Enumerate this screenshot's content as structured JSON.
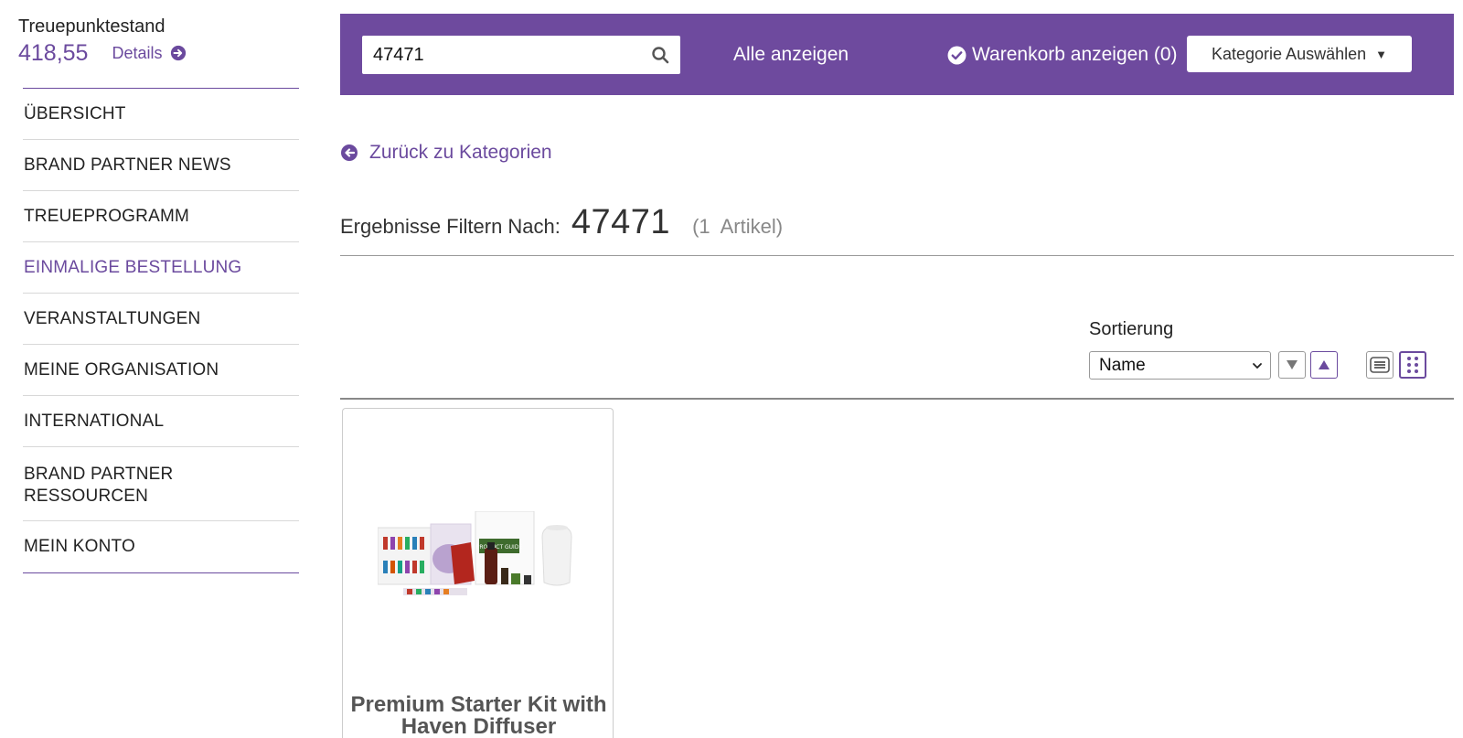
{
  "loyalty": {
    "label": "Treuepunktestand",
    "value": "418,55",
    "details_label": "Details"
  },
  "nav": {
    "items": [
      {
        "label": "ÜBERSICHT"
      },
      {
        "label": "BRAND PARTNER NEWS"
      },
      {
        "label": "TREUEPROGRAMM"
      },
      {
        "label": "EINMALIGE BESTELLUNG",
        "active": true
      },
      {
        "label": "VERANSTALTUNGEN"
      },
      {
        "label": "MEINE ORGANISATION"
      },
      {
        "label": "INTERNATIONAL"
      },
      {
        "label": "BRAND PARTNER RESSOURCEN"
      },
      {
        "label": "MEIN KONTO"
      }
    ]
  },
  "topbar": {
    "search_value": "47471",
    "show_all_label": "Alle anzeigen",
    "cart_label": "Warenkorb anzeigen (0)",
    "category_label": "Kategorie Auswählen"
  },
  "back_link": {
    "label": "Zurück zu Kategorien"
  },
  "results": {
    "label": "Ergebnisse Filtern Nach:",
    "term": "47471",
    "count": "(1  Artikel)"
  },
  "sort": {
    "label": "Sortierung",
    "selected": "Name"
  },
  "products": [
    {
      "title": "Premium Starter Kit with Haven Diffuser",
      "image_text": "PRODUCT GUIDE"
    }
  ],
  "colors": {
    "brand_purple": "#6e4a9e",
    "link_purple": "#6b4a9e"
  },
  "icons": {
    "search": "search-icon",
    "details": "arrow-circle-right-icon",
    "cart": "check-circle-icon",
    "back": "arrow-circle-left-icon"
  }
}
